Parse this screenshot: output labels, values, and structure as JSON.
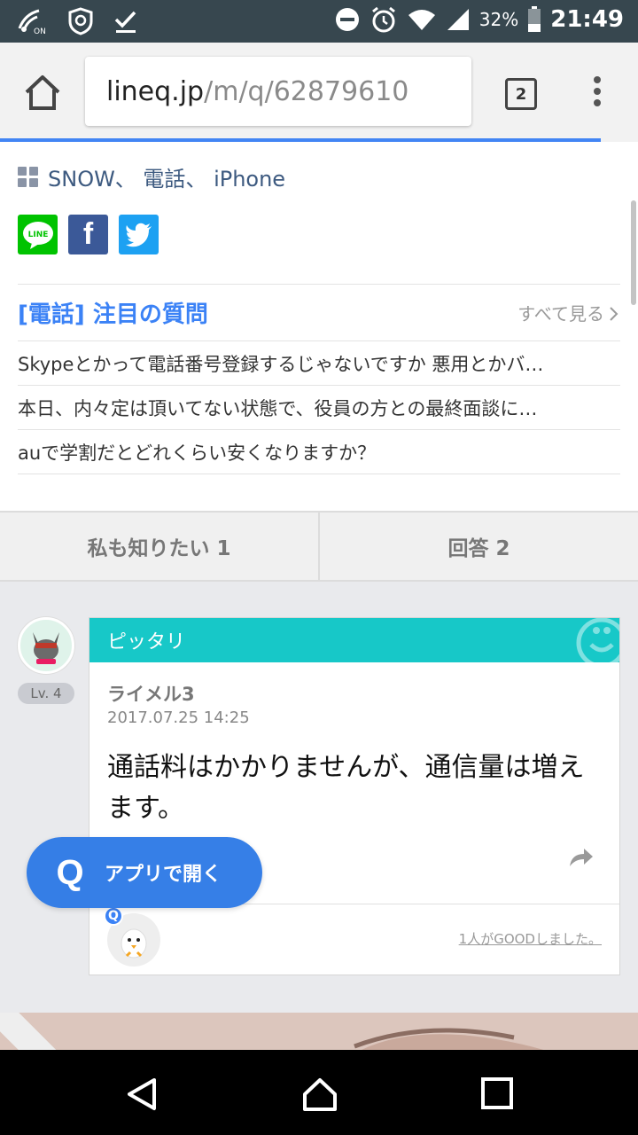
{
  "status_bar": {
    "battery": "32%",
    "time": "21:49"
  },
  "browser": {
    "url_host": "lineq.jp",
    "url_path": "/m/q/62879610",
    "tab_count": "2"
  },
  "tags": {
    "text": "SNOW、 電話、 iPhone"
  },
  "share": {
    "line_label": "LINE",
    "facebook_label": "f"
  },
  "popular": {
    "title": "[電話] 注目の質問",
    "see_all": "すべて見る",
    "questions": [
      "Skypeとかって電話番号登録するじゃないですか 悪用とかバ…",
      "本日、内々定は頂いてない状態で、役員の方との最終面談に…",
      "auで学割だとどれくらい安くなりますか？"
    ]
  },
  "tabs": {
    "want_to_know": "私も知りたい 1",
    "answers": "回答 2"
  },
  "answer": {
    "level": "Lv. 4",
    "badge": "ピッタリ",
    "user": "ライメル3",
    "date": "2017.07.25 14:25",
    "body": "通話料はかかりませんが、通信量は増えます。",
    "good_text": "1人がGOODしました。",
    "good_q": "Q"
  },
  "app_button": {
    "icon": "Q",
    "label": "アプリで開く"
  },
  "icons": {
    "home": "home-icon",
    "menu": "more-vert-icon",
    "back": "back-icon",
    "nav_home": "nav-home-icon",
    "recents": "recents-icon"
  },
  "colors": {
    "accent": "#3b82f6",
    "answer_header": "#17c8c8",
    "app_button": "#2b78e6"
  }
}
